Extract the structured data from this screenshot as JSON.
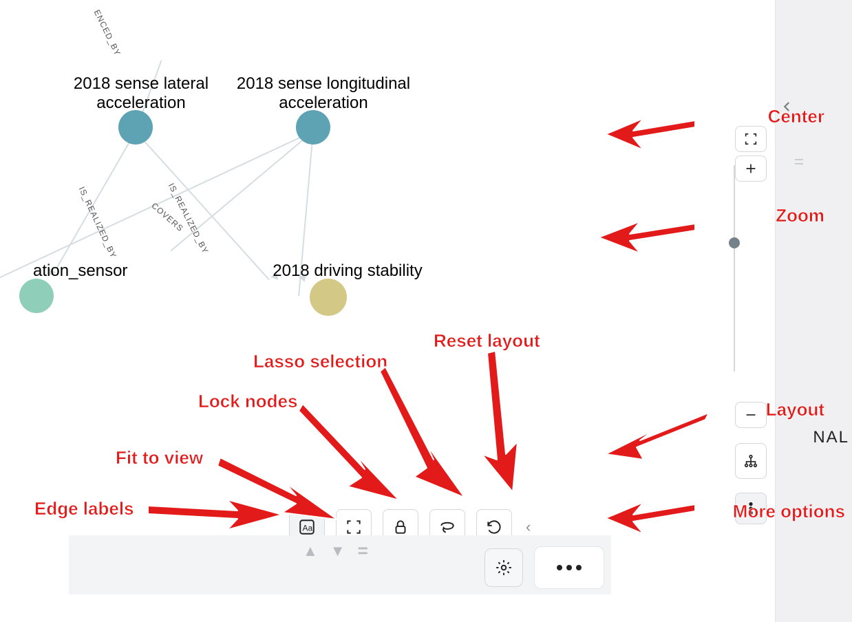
{
  "graph": {
    "nodes": {
      "lateral": {
        "label": "2018 sense lateral\nacceleration",
        "color": "#5da3b3"
      },
      "long": {
        "label": "2018 sense longitudinal\nacceleration",
        "color": "#5da3b3"
      },
      "sensor": {
        "label": "ation_sensor",
        "color": "#8fcfb9"
      },
      "stability": {
        "label": "2018 driving stability",
        "color": "#d3c886"
      }
    },
    "edge_labels": {
      "influenced_by": "ENCED_BY",
      "realized_by_1": "IS_REALIZED_BY",
      "covers": "COVERS",
      "realized_by_2": "IS_REALIZED_BY"
    }
  },
  "sidebar": {
    "clipped_label": "NAL"
  },
  "toolbar": {
    "edge_labels": "Aa",
    "fit_to_view": "fit",
    "lock_nodes": "lock",
    "lasso": "lasso",
    "reset_layout": "reset",
    "more": "more"
  },
  "annotations": {
    "center": "Center",
    "zoom": "Zoom",
    "layout": "Layout",
    "more_options": "More options",
    "edge_labels": "Edge labels",
    "fit_to_view": "Fit to view",
    "lock_nodes": "Lock nodes",
    "lasso": "Lasso selection",
    "reset_layout": "Reset layout"
  }
}
